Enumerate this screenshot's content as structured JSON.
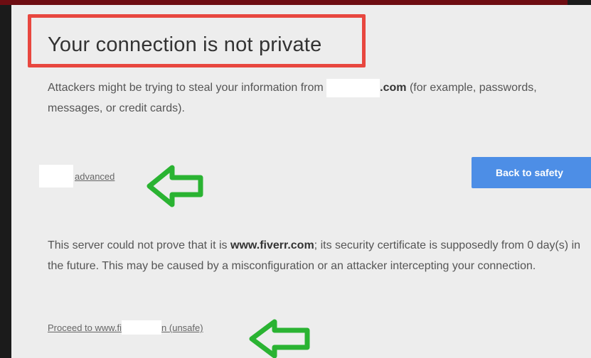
{
  "interstitial": {
    "title": "Your connection is not private",
    "description": {
      "prefix": "Attackers might be trying to steal your information from ",
      "domain_suffix": ".com",
      "suffix": " (for example, passwords, messages, or credit cards)."
    },
    "advanced_link": "advanced",
    "back_button": "Back to safety",
    "details": {
      "prefix": "This server could not prove that it is ",
      "domain": "www.fiverr.com",
      "suffix": "; its security certificate is supposedly from 0 day(s) in the future. This may be caused by a misconfiguration or an attacker intercepting your connection."
    },
    "proceed": {
      "prefix": "Proceed to www.fi",
      "suffix": "n (unsafe)"
    }
  },
  "colors": {
    "highlight_box": "#e8473f",
    "annotation_arrow": "#2ab332",
    "button_blue": "#4d8ee6",
    "top_bar": "#6e0d12"
  },
  "icons": [
    "left-arrow-annotation-icon",
    "left-arrow-annotation-icon"
  ]
}
